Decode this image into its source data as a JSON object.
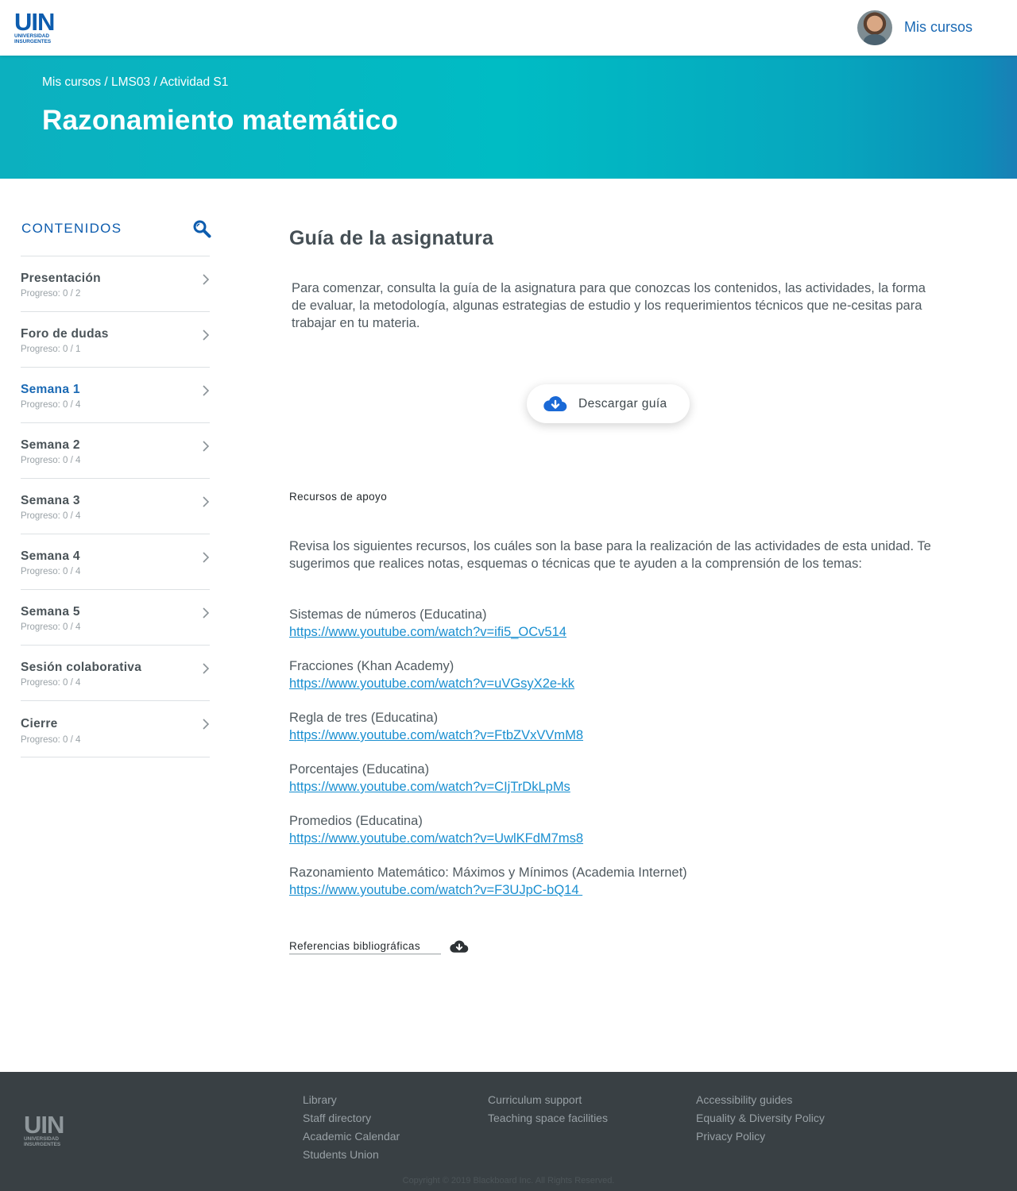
{
  "header": {
    "logo_text": "UIN",
    "logo_subtitle_1": "UNIVERSIDAD",
    "logo_subtitle_2": "INSURGENTES",
    "user_link": "Mis cursos"
  },
  "banner": {
    "breadcrumb": [
      "Mis cursos",
      "LMS03",
      "Actividad S1"
    ],
    "breadcrumb_sep": " / ",
    "title": "Razonamiento matemático"
  },
  "sidebar": {
    "title": "CONTENIDOS",
    "items": [
      {
        "label": "Presentación",
        "progress": "Progreso: 0 / 2"
      },
      {
        "label": "Foro de dudas",
        "progress": "Progreso: 0 / 1"
      },
      {
        "label": "Semana 1",
        "progress": "Progreso: 0 / 4"
      },
      {
        "label": "Semana 2",
        "progress": "Progreso: 0 / 4"
      },
      {
        "label": "Semana 3",
        "progress": "Progreso: 0 / 4"
      },
      {
        "label": "Semana 4",
        "progress": "Progreso: 0 / 4"
      },
      {
        "label": "Semana 5",
        "progress": "Progreso: 0 / 4"
      },
      {
        "label": "Sesión colaborativa",
        "progress": "Progreso: 0 / 4"
      },
      {
        "label": "Cierre",
        "progress": "Progreso: 0 / 4"
      }
    ]
  },
  "main": {
    "title": "Guía de la asignatura",
    "intro": "Para comenzar, consulta la guía de la asignatura para que conozcas los contenidos, las actividades, la forma de evaluar, la metodología, algunas estrategias de estudio y los requerimientos técnicos que ne-cesitas para trabajar en tu materia.",
    "download_label": "Descargar guía",
    "resources_heading": "Recursos de apoyo",
    "resources_intro": "Revisa los siguientes recursos, los cuáles son la base para la realización de las actividades de esta unidad. Te sugerimos que realices notas, esquemas o técnicas que te ayuden a la comprensión de los temas:",
    "resources": [
      {
        "name": "Sistemas de números (Educatina)",
        "url": "https://www.youtube.com/watch?v=ifi5_OCv514"
      },
      {
        "name": "Fracciones (Khan Academy)",
        "url": "https://www.youtube.com/watch?v=uVGsyX2e-kk"
      },
      {
        "name": "Regla de tres (Educatina)",
        "url": "https://www.youtube.com/watch?v=FtbZVxVVmM8"
      },
      {
        "name": "Porcentajes (Educatina)",
        "url": "https://www.youtube.com/watch?v=CIjTrDkLpMs"
      },
      {
        "name": "Promedios (Educatina)",
        "url": "https://www.youtube.com/watch?v=UwlKFdM7ms8"
      },
      {
        "name": "Razonamiento Matemático: Máximos y Mínimos (Academia Internet)",
        "url": "https://www.youtube.com/watch?v=F3UJpC-bQ14 "
      }
    ],
    "references_label": "Referencias bibliográficas"
  },
  "footer": {
    "col1": [
      "Library",
      "Staff directory",
      "Academic Calendar",
      "Students Union"
    ],
    "col2": [
      "Curriculum support",
      "Teaching space facilities"
    ],
    "col3": [
      "Accessibility guides",
      "Equality & Diversity Policy",
      "Privacy Policy"
    ],
    "copyright": "Copyright © 2019 Blackboard Inc. All Rights Reserved."
  },
  "colors": {
    "brand_blue": "#0d5cae",
    "banner_teal": "#00bcc4",
    "link_blue": "#1a8fd0",
    "footer_bg": "#394044"
  },
  "active_item": "Semana 1"
}
